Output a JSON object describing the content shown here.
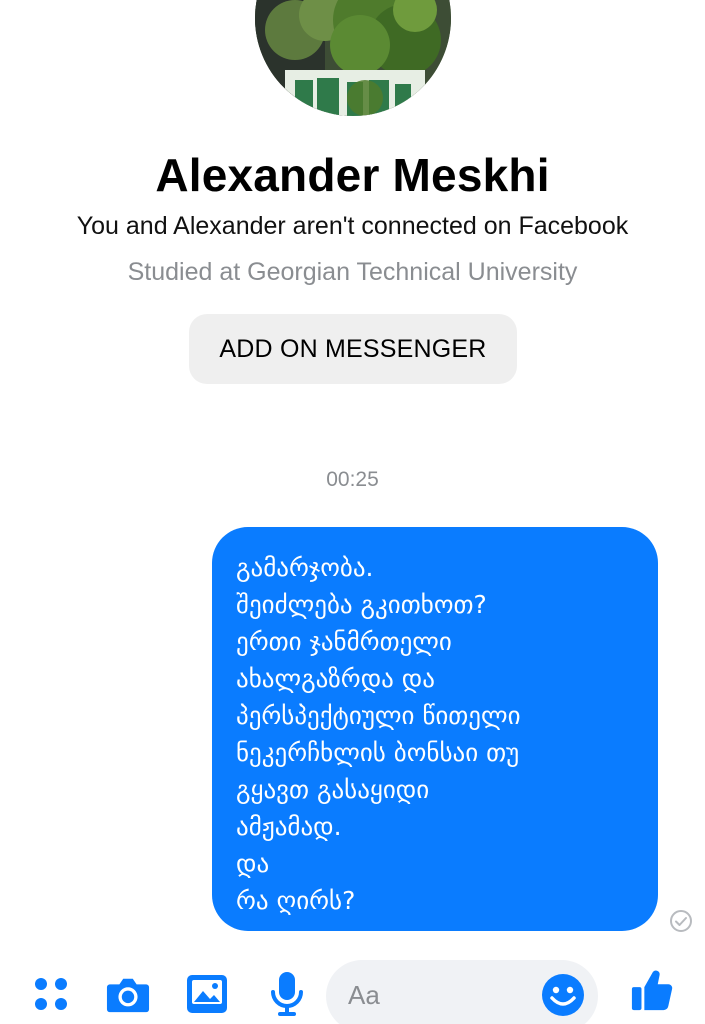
{
  "profile": {
    "name": "Alexander Meskhi",
    "connection_note": "You and Alexander aren't connected on Facebook",
    "study": "Studied at Georgian Technical University",
    "add_button_label": "ADD ON MESSENGER"
  },
  "conversation": {
    "timestamp": "00:25",
    "messages": [
      {
        "sender": "me",
        "lines": [
          "გამარჯობა.",
          "შეიძლება გკითხოთ?",
          "ერთი ჯანმრთელი",
          "ახალგაზრდა და",
          "პერსპექტიული წითელი",
          "ნეკერჩხლის ბონსაი თუ",
          "გყავთ გასაყიდი",
          "ამჟამად.",
          "და",
          "რა ღირს?"
        ],
        "status_icon": "seen-check-icon"
      }
    ]
  },
  "composer": {
    "placeholder": "Aa",
    "icons": [
      "apps-icon",
      "camera-icon",
      "image-icon",
      "microphone-icon",
      "emoji-icon",
      "thumbs-up-icon"
    ]
  },
  "colors": {
    "accent": "#0a7cff",
    "secondary_text": "#8a8d91",
    "button_bg": "#efefef",
    "input_bg": "#f0f2f5"
  }
}
